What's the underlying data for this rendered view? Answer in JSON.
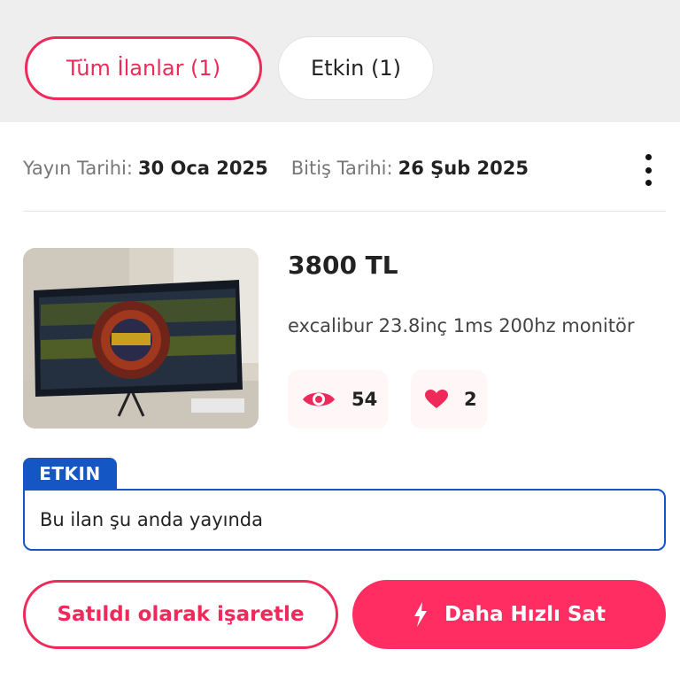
{
  "tabs": [
    {
      "label": "Tüm İlanlar (1)",
      "active": true
    },
    {
      "label": "Etkin (1)",
      "active": false
    }
  ],
  "listing": {
    "publish_label": "Yayın Tarihi:",
    "publish_date": "30 Oca 2025",
    "end_label": "Bitiş Tarihi:",
    "end_date": "26 Şub 2025",
    "price": "3800 TL",
    "title": "excalibur 23.8inç 1ms 200hz monitör",
    "views": "54",
    "likes": "2",
    "photo_icon": "monitor-photo"
  },
  "status": {
    "tag": "ETKIN",
    "message": "Bu ilan şu anda yayında"
  },
  "actions": {
    "mark_sold": "Satıldı olarak işaretle",
    "sell_faster": "Daha Hızlı Sat",
    "sell_faster_icon": "lightning-icon"
  },
  "colors": {
    "brand": "#ee2a5a",
    "brand_fill": "#ff2d62",
    "status_blue": "#1457c4",
    "stat_bg": "#fff6f7"
  }
}
